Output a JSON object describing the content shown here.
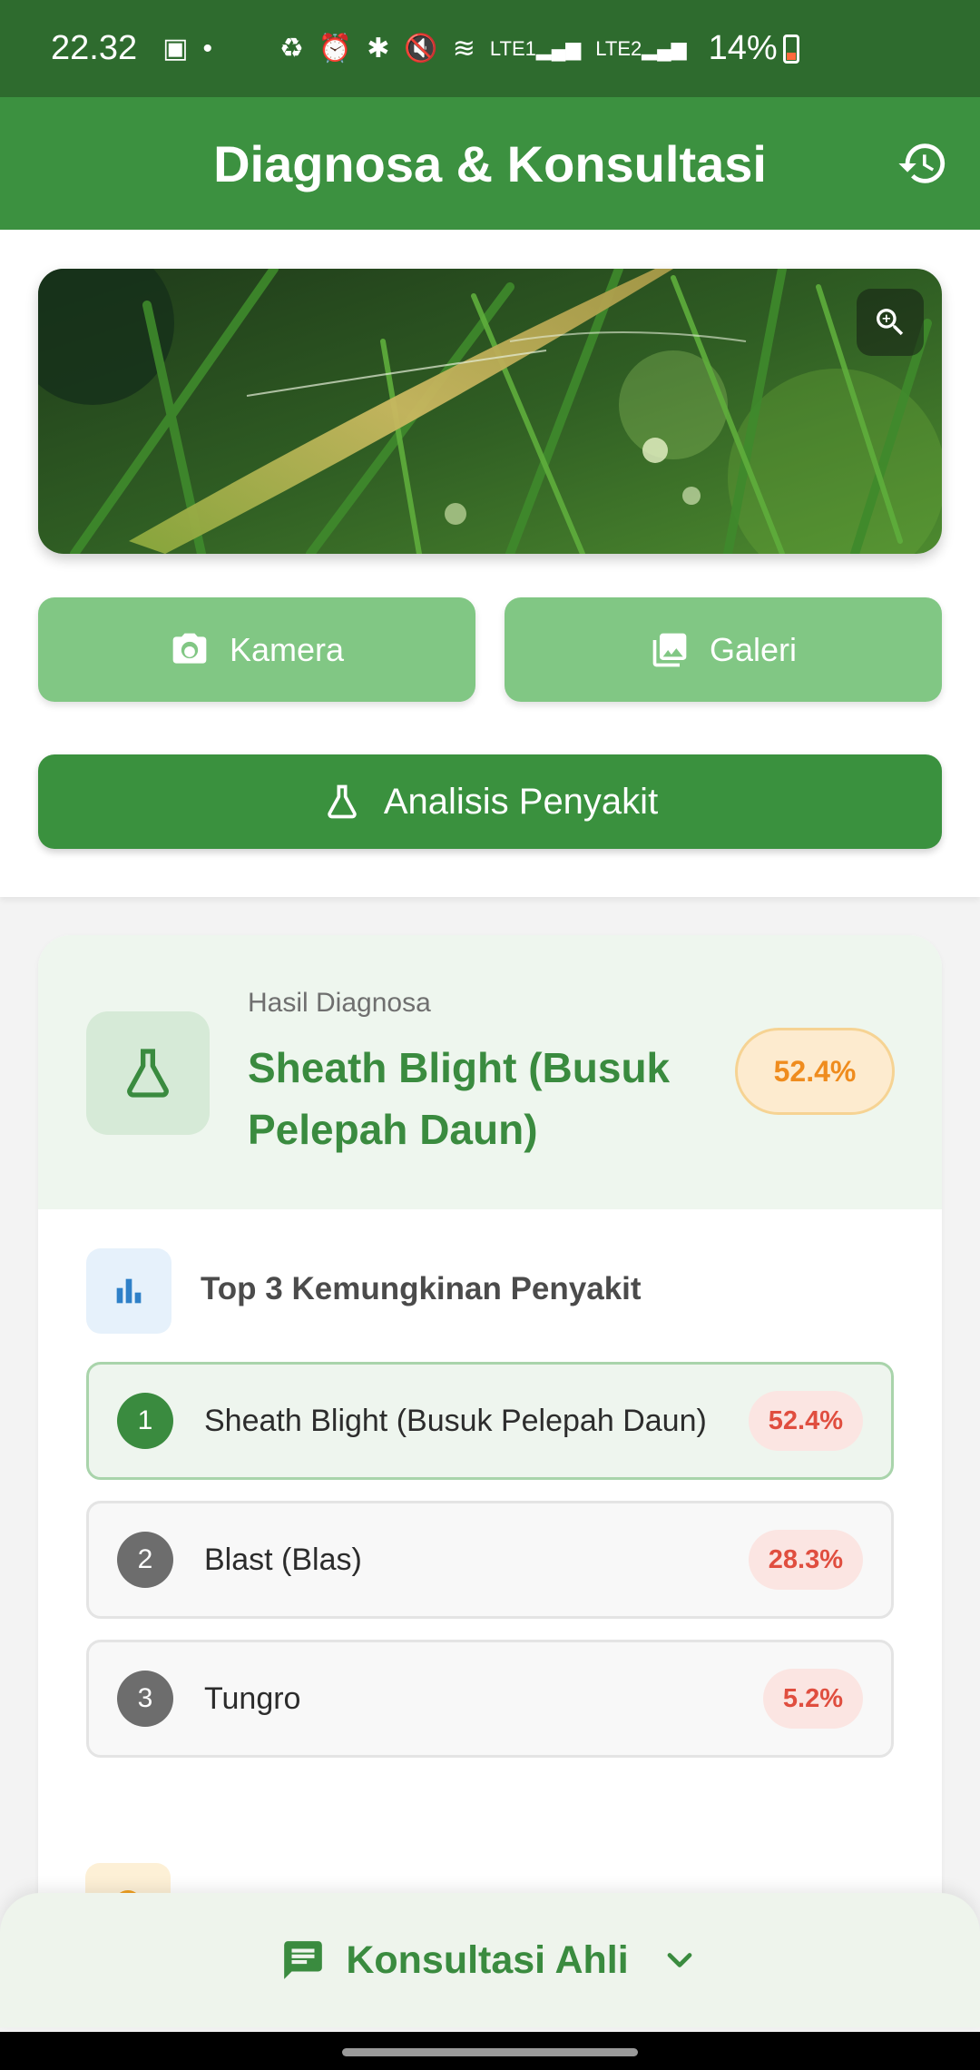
{
  "status_bar": {
    "time": "22.32",
    "battery": "14%",
    "icons": [
      "image-icon",
      "dot-icon",
      "battery-saver-icon",
      "alarm-icon",
      "bluetooth-icon",
      "mute-icon",
      "wifi-icon",
      "signal-lte1-icon",
      "signal-lte2-icon"
    ]
  },
  "header": {
    "title": "Diagnosa & Konsultasi",
    "history_icon": "history-icon"
  },
  "actions": {
    "camera_label": "Kamera",
    "gallery_label": "Galeri",
    "analyze_label": "Analisis Penyakit"
  },
  "result": {
    "label": "Hasil Diagnosa",
    "title": "Sheath Blight (Busuk Pelepah Daun)",
    "confidence": "52.4%",
    "top3_title": "Top 3 Kemungkinan Penyakit",
    "top3": [
      {
        "rank": "1",
        "name": "Sheath Blight (Busuk Pelepah Daun)",
        "pct": "52.4%"
      },
      {
        "rank": "2",
        "name": "Blast (Blas)",
        "pct": "28.3%"
      },
      {
        "rank": "3",
        "name": "Tungro",
        "pct": "5.2%"
      }
    ]
  },
  "sheet": {
    "label": "Konsultasi Ahli"
  },
  "colors": {
    "primary": "#3c9140",
    "status_bar": "#2e6b2e",
    "light_button": "#81c784",
    "badge_orange": "#ef8c1e",
    "badge_red": "#e04e3f"
  }
}
